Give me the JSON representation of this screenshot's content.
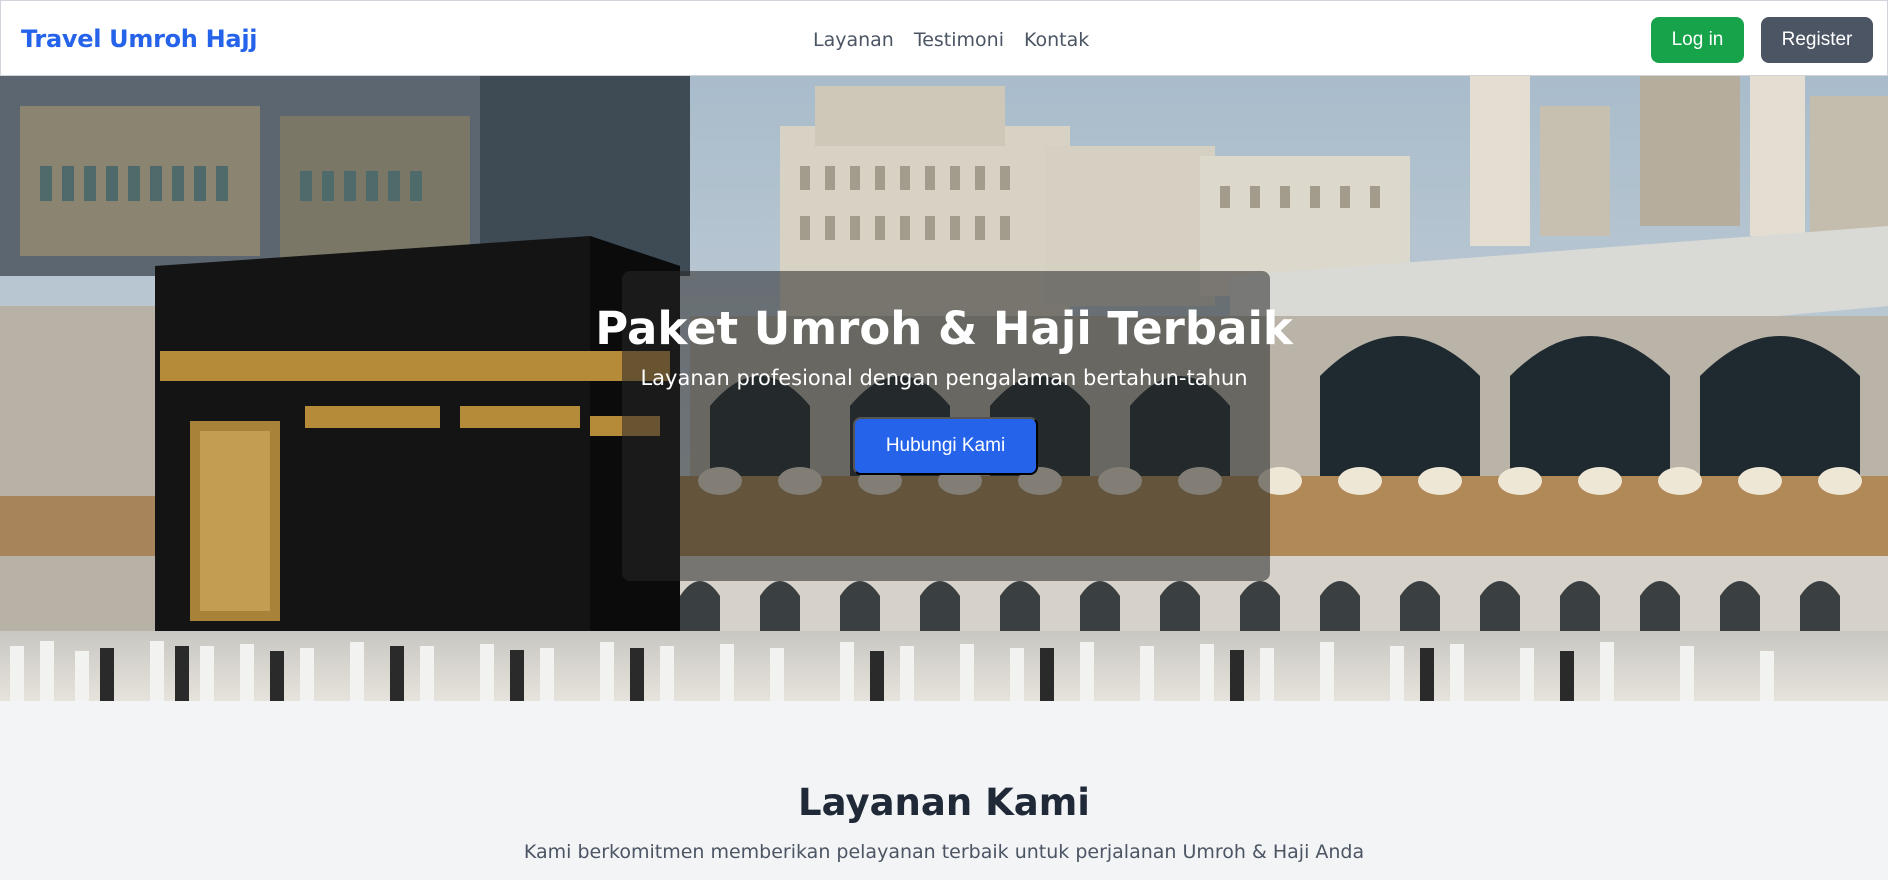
{
  "navbar": {
    "brand": "Travel Umroh Hajj",
    "links": [
      "Layanan",
      "Testimoni",
      "Kontak"
    ],
    "login_label": "Log in",
    "register_label": "Register"
  },
  "hero": {
    "title": "Paket Umroh & Haji Terbaik",
    "subtitle": "Layanan profesional dengan pengalaman bertahun-tahun",
    "cta_label": "Hubungi Kami"
  },
  "services": {
    "title": "Layanan Kami",
    "subtitle": "Kami berkomitmen memberikan pelayanan terbaik untuk perjalanan Umroh & Haji Anda"
  },
  "colors": {
    "brand": "#2563eb",
    "login": "#16a34a",
    "register": "#4b5563",
    "cta": "#2563eb"
  }
}
